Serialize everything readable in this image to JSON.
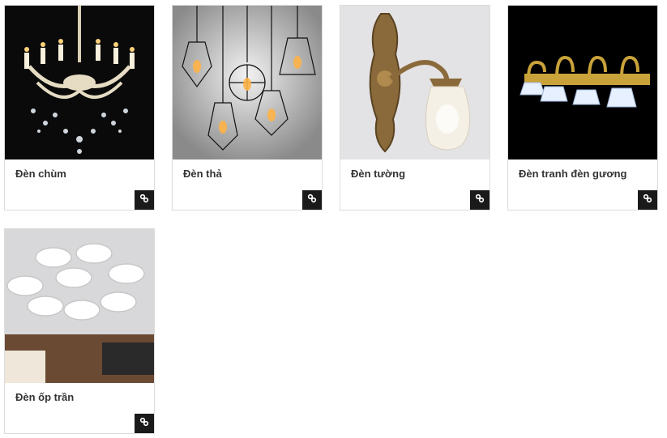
{
  "categories": [
    {
      "title": "Đèn chùm",
      "image": "crystal-chandelier",
      "link_icon": "link-icon"
    },
    {
      "title": "Đèn thả",
      "image": "pendant-cage-lamps",
      "link_icon": "link-icon"
    },
    {
      "title": "Đèn tường",
      "image": "bronze-wall-lamp",
      "link_icon": "link-icon"
    },
    {
      "title": "Đèn tranh đèn gương",
      "image": "gold-mirror-lamp",
      "link_icon": "link-icon"
    },
    {
      "title": "Đèn ốp trần",
      "image": "led-flower-ceiling-lamp",
      "link_icon": "link-icon"
    }
  ],
  "colors": {
    "card_border": "#dcdcdc",
    "title_text": "#333333",
    "link_button_bg": "#1a1a1a"
  }
}
